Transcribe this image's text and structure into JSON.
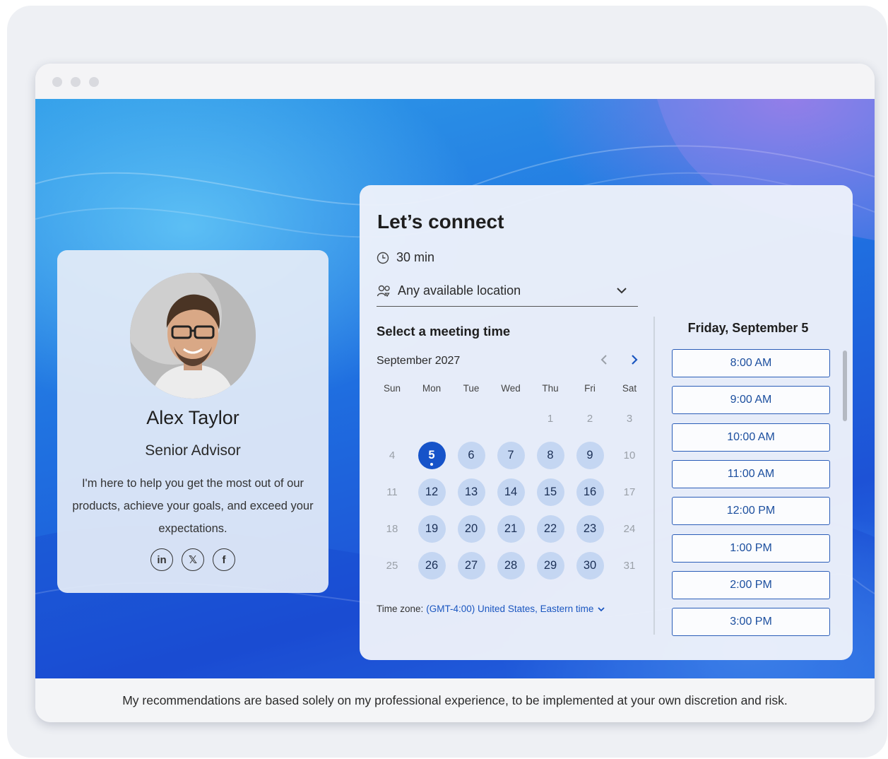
{
  "footer": {
    "disclaimer": "My recommendations are based solely on my professional experience, to be implemented at your own discretion and risk."
  },
  "profile": {
    "name": "Alex Taylor",
    "role": "Senior Advisor",
    "bio": "I'm here to help you get the most out of our products, achieve your goals, and exceed your expectations.",
    "socials": [
      {
        "icon": "linkedin-icon",
        "glyph": "in"
      },
      {
        "icon": "x-icon",
        "glyph": "𝕏"
      },
      {
        "icon": "facebook-icon",
        "glyph": "f"
      }
    ]
  },
  "booking": {
    "title": "Let’s connect",
    "duration": "30 min",
    "location": "Any available location",
    "select_label": "Select a meeting time",
    "month": "September 2027",
    "weekdays": [
      "Sun",
      "Mon",
      "Tue",
      "Wed",
      "Thu",
      "Fri",
      "Sat"
    ],
    "weeks": [
      [
        null,
        null,
        null,
        null,
        "1",
        "2",
        "3"
      ],
      [
        "4",
        "5",
        "6",
        "7",
        "8",
        "9",
        "10"
      ],
      [
        "11",
        "12",
        "13",
        "14",
        "15",
        "16",
        "17"
      ],
      [
        "18",
        "19",
        "20",
        "21",
        "22",
        "23",
        "24"
      ],
      [
        "25",
        "26",
        "27",
        "28",
        "29",
        "30",
        "31"
      ]
    ],
    "available_days": [
      "5",
      "6",
      "7",
      "8",
      "9",
      "12",
      "13",
      "14",
      "15",
      "16",
      "19",
      "20",
      "21",
      "22",
      "23",
      "26",
      "27",
      "28",
      "29",
      "30"
    ],
    "selected_day": "5",
    "timezone_label": "Time zone:",
    "timezone_value": "(GMT-4:00) United States, Eastern time",
    "date_heading": "Friday, September 5",
    "slots": [
      "8:00 AM",
      "9:00 AM",
      "10:00 AM",
      "11:00 AM",
      "12:00 PM",
      "1:00 PM",
      "2:00 PM",
      "3:00 PM"
    ]
  },
  "colors": {
    "accent": "#1653c9",
    "available_day": "#c4d6f2",
    "slot_border": "#2a5db8"
  }
}
